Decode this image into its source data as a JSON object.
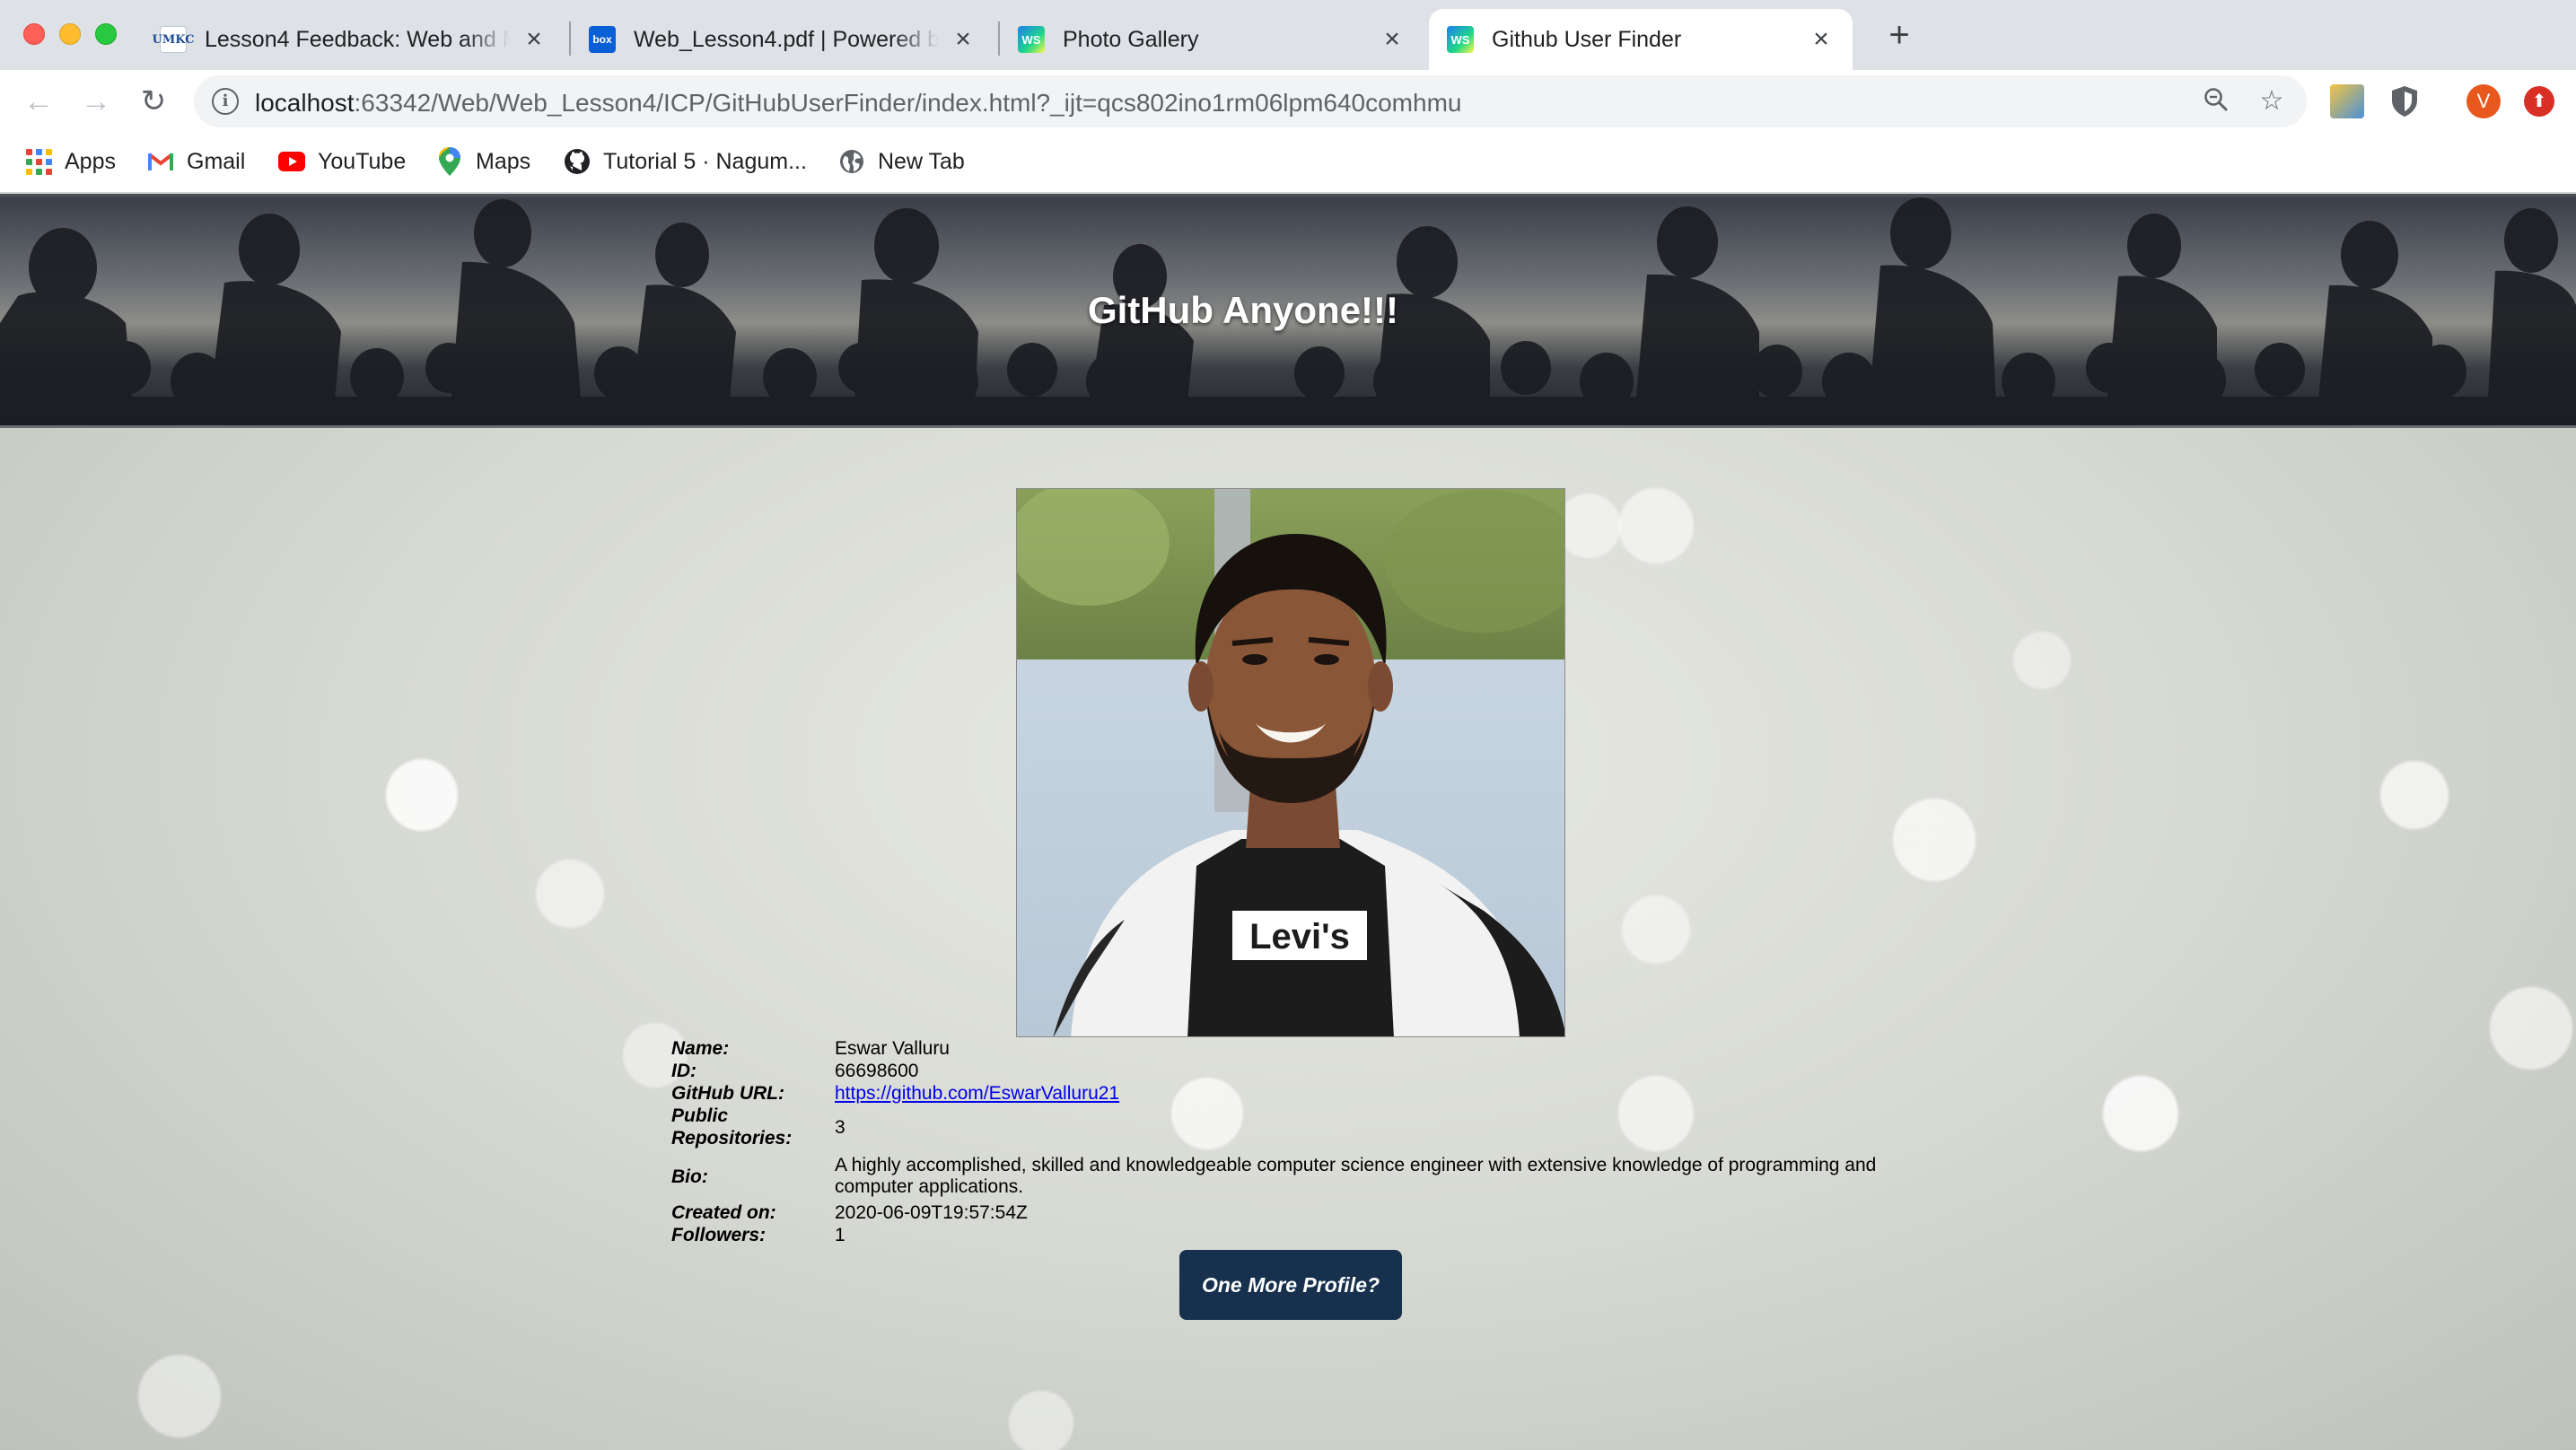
{
  "browser": {
    "tabs": [
      {
        "title": "Lesson4 Feedback: Web and Mobile Programming",
        "favicon": "umkc-icon"
      },
      {
        "title": "Web_Lesson4.pdf | Powered by Box",
        "favicon": "box-icon"
      },
      {
        "title": "Photo Gallery",
        "favicon": "webstorm-icon"
      },
      {
        "title": "Github User Finder",
        "favicon": "webstorm-icon",
        "active": true
      }
    ],
    "url_host": "localhost",
    "url_rest": ":63342/Web/Web_Lesson4/ICP/GitHubUserFinder/index.html?_ijt=qcs802ino1rm06lpm640comhmu",
    "profile_initial": "V",
    "bookmarks": [
      {
        "label": "Apps",
        "icon": "apps-grid-icon"
      },
      {
        "label": "Gmail",
        "icon": "gmail-icon"
      },
      {
        "label": "YouTube",
        "icon": "youtube-icon"
      },
      {
        "label": "Maps",
        "icon": "maps-icon"
      },
      {
        "label": "Tutorial 5 · Nagum...",
        "icon": "github-icon"
      },
      {
        "label": "New Tab",
        "icon": "globe-icon"
      }
    ]
  },
  "page": {
    "heading": "GitHub Anyone!!!",
    "profile": {
      "name_label": "Name:",
      "name": "Eswar Valluru",
      "id_label": "ID:",
      "id": "66698600",
      "url_label": "GitHub URL:",
      "url": "https://github.com/EswarValluru21",
      "repos_label_1": "Public",
      "repos_label_2": "Repositories:",
      "repos": "3",
      "bio_label": "Bio:",
      "bio": "A highly accomplished, skilled and knowledgeable computer science engineer with extensive knowledge of programming and computer applications.",
      "created_label": "Created on:",
      "created": "2020-06-09T19:57:54Z",
      "followers_label": "Followers:",
      "followers": "1"
    },
    "button_label": "One More Profile?",
    "avatar_shirt_text": "Levi's"
  },
  "colors": {
    "button_bg": "#16304d",
    "link": "#0000ee",
    "hero_text": "#ffffff"
  }
}
